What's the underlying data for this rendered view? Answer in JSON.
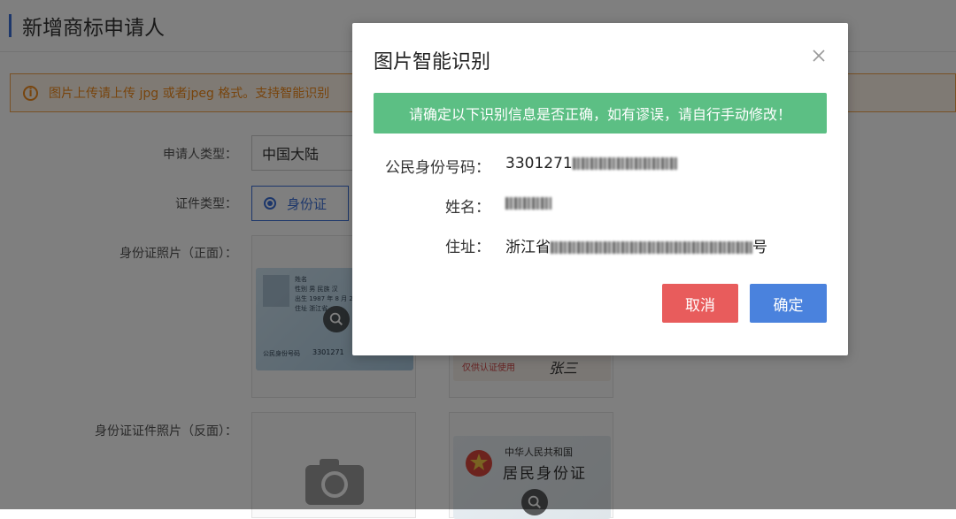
{
  "page": {
    "title": "新增商标申请人",
    "notice": "图片上传请上传 jpg 或者jpeg 格式。支持智能识别",
    "form": {
      "applicant_type_label": "申请人类型：",
      "applicant_type_value": "中国大陆",
      "cert_type_label": "证件类型：",
      "cert_type_option": "身份证",
      "front_label": "身份证照片（正面）：",
      "back_label": "身份证证件照片（反面）："
    },
    "id_card_front": {
      "line1": "姓名",
      "line2": "性别 男 民族 汉",
      "line3": "出生 1987 年 8 月 24 日",
      "line4": "住址 浙江省",
      "id_prefix": "公民身份号码",
      "id_number": "3301271"
    },
    "signature_sample": {
      "stamp": "仅供认证使用",
      "name": "张三"
    },
    "id_card_back": {
      "country": "中华人民共和国",
      "title": "居民身份证"
    }
  },
  "modal": {
    "title": "图片智能识别",
    "banner": "请确定以下识别信息是否正确，如有谬误，请自行手动修改！",
    "fields": {
      "id_label": "公民身份号码：",
      "id_value": "3301271",
      "name_label": "姓名：",
      "address_label": "住址：",
      "address_value": "浙江省",
      "address_suffix": "号"
    },
    "cancel": "取消",
    "confirm": "确定"
  },
  "colors": {
    "accent": "#3b6fd6",
    "warning": "#f08a1c",
    "success": "#5cbf84",
    "danger": "#e85c5c",
    "primary": "#4a82dd"
  },
  "icons": [
    "info-icon",
    "zoom-icon",
    "camera-icon",
    "close-icon",
    "radio-icon",
    "national-emblem-icon"
  ]
}
